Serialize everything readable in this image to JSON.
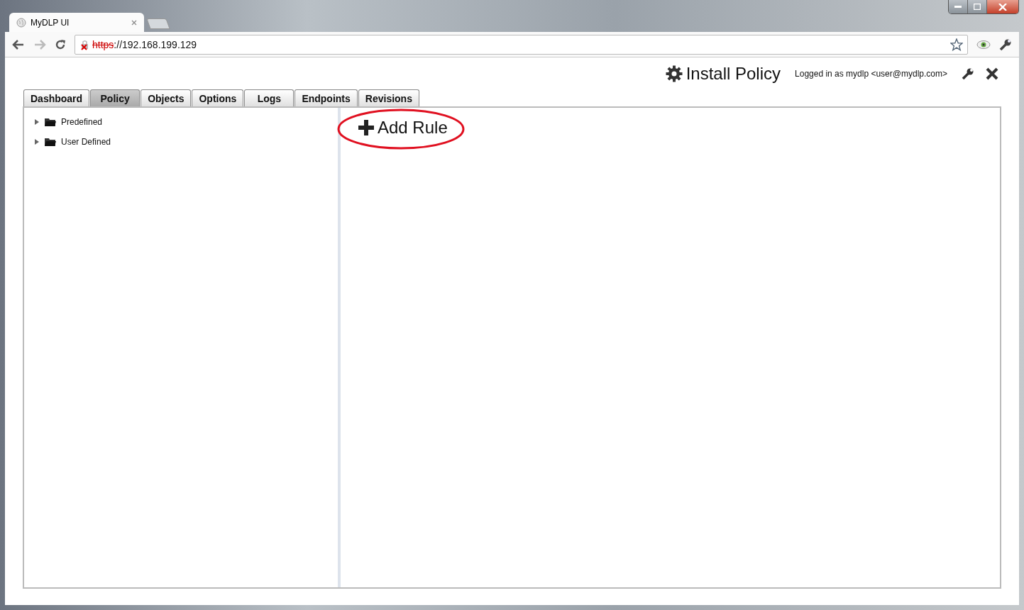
{
  "browser": {
    "tab_title": "MyDLP UI",
    "url_scheme": "https",
    "url_rest": "://192.168.199.129"
  },
  "header": {
    "install_button": "Install Policy",
    "login_text": "Logged in as mydlp <user@mydlp.com>"
  },
  "tabs": [
    {
      "label": "Dashboard",
      "selected": false
    },
    {
      "label": "Policy",
      "selected": true
    },
    {
      "label": "Objects",
      "selected": false
    },
    {
      "label": "Options",
      "selected": false
    },
    {
      "label": "Logs",
      "selected": false
    },
    {
      "label": "Endpoints",
      "selected": false
    },
    {
      "label": "Revisions",
      "selected": false
    }
  ],
  "tree": [
    {
      "label": "Predefined",
      "expanded": false
    },
    {
      "label": "User Defined",
      "expanded": false
    }
  ],
  "add_rule_button": "Add Rule"
}
